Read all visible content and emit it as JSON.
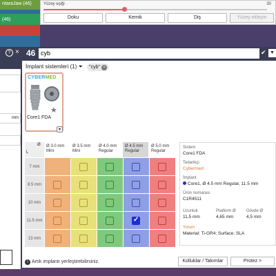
{
  "background": {
    "left_items": [
      "ntaraJaw (46)",
      "(46)"
    ]
  },
  "slider": {
    "label": "Yüzey eşiği",
    "value_text": "30",
    "fill_percent": 36
  },
  "segment_buttons": [
    "Doku",
    "Kemik",
    "Diş",
    "Yüzey ekleyin"
  ],
  "search": {
    "help_label": "?",
    "close_label": "×",
    "count": "46",
    "value": "cyb",
    "confirm_icon": "checkmark-icon",
    "dropdown_icon": "chevron-down-icon"
  },
  "left_fields": [
    "",
    "mm",
    "",
    ""
  ],
  "filter": {
    "title": "İmplant sistemleri (1)",
    "chip": "\"cyb\"",
    "chip_close": "×"
  },
  "implant_card": {
    "brand_cyber": "CYBER",
    "brand_med": "MED",
    "label": "Core1 FDA",
    "icons": [
      "implant-screw-icon",
      "disc-icon",
      "star-icon",
      "lock-icon"
    ]
  },
  "grid": {
    "corner_top": "Ø",
    "corner_bottom": "L",
    "columns": [
      {
        "line1": "Ø 3.0 mm",
        "line2": "Mini"
      },
      {
        "line1": "Ø 3.5 mm",
        "line2": "Mini"
      },
      {
        "line1": "Ø 4.0 mm",
        "line2": "Regular"
      },
      {
        "line1": "Ø 4.5 mm",
        "line2": "Regular"
      },
      {
        "line1": "Ø 5.0 mm",
        "line2": "Regular"
      }
    ],
    "selected_column_index": 3,
    "column_colors": [
      "#f0b27a",
      "#e8e07a",
      "#7fc97f",
      "#8f9fe6",
      "#f08080"
    ],
    "checkbox_border_colors": [
      "#c97a2c",
      "#b0a02a",
      "#2e8a2e",
      "#3a4bb0",
      "#c93a3a"
    ],
    "rows": [
      "7 mm",
      "8.5 mm",
      "10 mm",
      "11.5 mm",
      "13 mm"
    ],
    "cells": [
      [
        0,
        1,
        1,
        1,
        1
      ],
      [
        1,
        1,
        1,
        1,
        1
      ],
      [
        1,
        1,
        1,
        1,
        1
      ],
      [
        1,
        1,
        1,
        2,
        1
      ],
      [
        1,
        1,
        1,
        1,
        1
      ]
    ]
  },
  "details": {
    "sistem_label": "Sistem",
    "sistem_value": "Core1 FDA",
    "tedarikci_label": "Tedarikçi",
    "tedarikci_value": "Cybermed",
    "implant_label": "İmplant",
    "implant_value": "Core1, Ø 4.5 mm Regular, 11.5 mm",
    "urun_label": "Ürün numarası",
    "urun_value": "C1R4511",
    "uzunluk_label": "Uzunluk",
    "uzunluk_value": "11,5 mm",
    "platform_label": "Platform Ø",
    "platform_value": "4,65 mm",
    "govde_label": "Gövde Ø",
    "govde_value": "4,5 mm",
    "yorum_label": "Yorum",
    "yorum_value": "Material: Ti-GR4; Surface: SLA"
  },
  "footer": {
    "note": "Artık implantı yerleştirebilirsiniz.",
    "btn_kolluklar": "Kolluklar / Takımlar",
    "btn_protez": "Protez >"
  },
  "colors": {
    "accent": "#e35b6b",
    "selected_checkbox": "#1d2ecf",
    "orange_text": "#e6732c"
  }
}
